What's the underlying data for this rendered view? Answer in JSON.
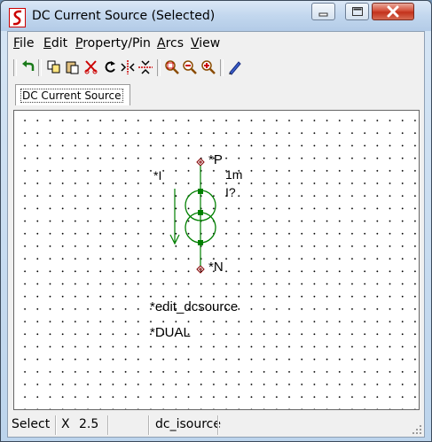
{
  "window": {
    "title": "DC Current Source (Selected)"
  },
  "menu": [
    "File",
    "Edit",
    "Property/Pin",
    "Arcs",
    "View"
  ],
  "tab": {
    "label": "DC Current Source"
  },
  "symbol": {
    "ref_label": "*I",
    "value_1": "1m",
    "value_2": "I?",
    "pin_p": "*P",
    "pin_n": "*N",
    "edit_text": "*edit_dcsource",
    "dual_text": "*DUAL",
    "color": "#008000",
    "pin_color": "#800000"
  },
  "status": {
    "mode": "Select",
    "coord_label": "X",
    "coord_value": "2.5",
    "model": "dc_isource"
  }
}
